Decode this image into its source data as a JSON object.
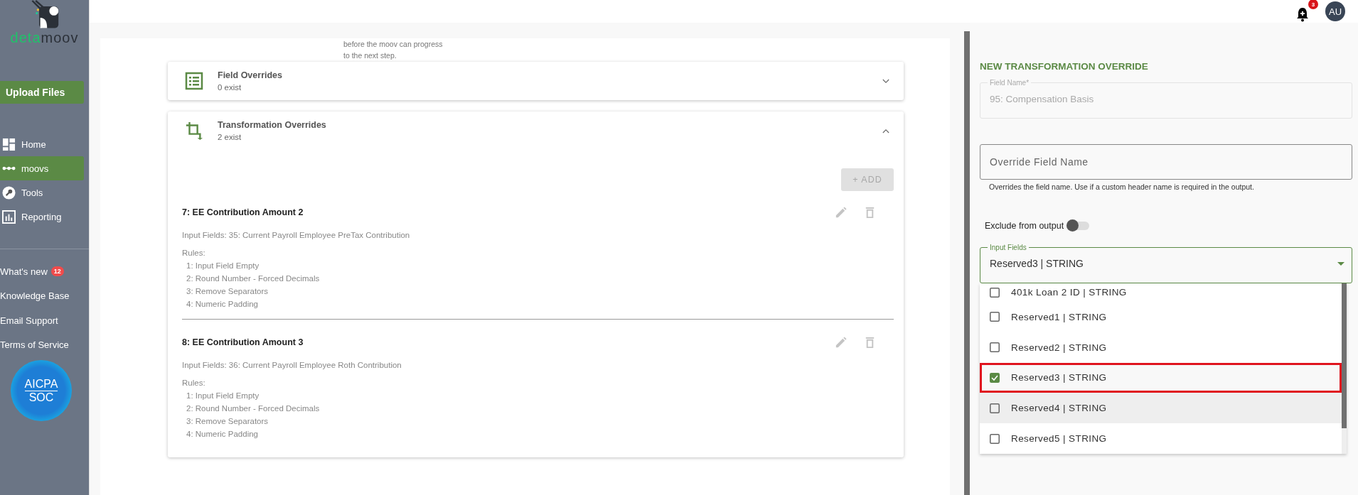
{
  "sidebar": {
    "logo": {
      "part_1": "deta",
      "part_2": "moov"
    },
    "upload_button": "Upload Files",
    "nav": [
      {
        "label": "Home",
        "kind": "grid",
        "selected": false
      },
      {
        "label": "moovs",
        "kind": "dots",
        "selected": true
      },
      {
        "label": "Tools",
        "kind": "wrench",
        "selected": false
      },
      {
        "label": "Reporting",
        "kind": "chart",
        "selected": false
      }
    ],
    "links": [
      {
        "label": "What's new",
        "badge": "12"
      },
      {
        "label": "Knowledge Base"
      },
      {
        "label": "Email Support"
      },
      {
        "label": "Terms of Service"
      }
    ],
    "certification": {
      "line_1": "AICPA",
      "line_2": "SOC"
    }
  },
  "header": {
    "notification_count": "3",
    "avatar": "AU"
  },
  "main": {
    "intro_lines": [
      "before the moov can progress",
      "to the next step."
    ],
    "sections": [
      {
        "title": "Field Overrides",
        "subtitle": "0 exist",
        "kind": "list",
        "expanded": false
      },
      {
        "title": "Transformation Overrides",
        "subtitle": "2 exist",
        "kind": "crop",
        "expanded": true
      }
    ],
    "add_button": {
      "label": "+ ADD",
      "disabled": true
    },
    "overrides": [
      {
        "title": "7: EE Contribution Amount 2",
        "input_fields": "Input Fields: 35: Current Payroll Employee PreTax Contribution",
        "rules_label": "Rules:",
        "rules": [
          "1: Input Field Empty",
          "2: Round Number - Forced Decimals",
          "3: Remove Separators",
          "4: Numeric Padding"
        ]
      },
      {
        "title": "8: EE Contribution Amount 3",
        "input_fields": "Input Fields: 36: Current Payroll Employee Roth Contribution",
        "rules_label": "Rules:",
        "rules": [
          "1: Input Field Empty",
          "2: Round Number - Forced Decimals",
          "3: Remove Separators",
          "4: Numeric Padding"
        ]
      }
    ]
  },
  "panel": {
    "title": "NEW TRANSFORMATION OVERRIDE",
    "field_name": {
      "label": "Field Name*",
      "value": "95: Compensation Basis",
      "disabled": true
    },
    "override_name": {
      "placeholder": "Override Field Name",
      "helper": "Overrides the field name. Use if a custom header name is required in the output."
    },
    "exclude": {
      "label": "Exclude from output",
      "on": false
    },
    "input_fields": {
      "label": "Input Fields",
      "value": "Reserved3 | STRING",
      "options": [
        {
          "label": "401k Loan 2 ID | STRING",
          "checked": false,
          "hovered": false
        },
        {
          "label": "Reserved1 | STRING",
          "checked": false,
          "hovered": false
        },
        {
          "label": "Reserved2 | STRING",
          "checked": false,
          "hovered": false
        },
        {
          "label": "Reserved3 | STRING",
          "checked": true,
          "hovered": false
        },
        {
          "label": "Reserved4 | STRING",
          "checked": false,
          "hovered": true
        },
        {
          "label": "Reserved5 | STRING",
          "checked": false,
          "hovered": false
        }
      ]
    }
  }
}
